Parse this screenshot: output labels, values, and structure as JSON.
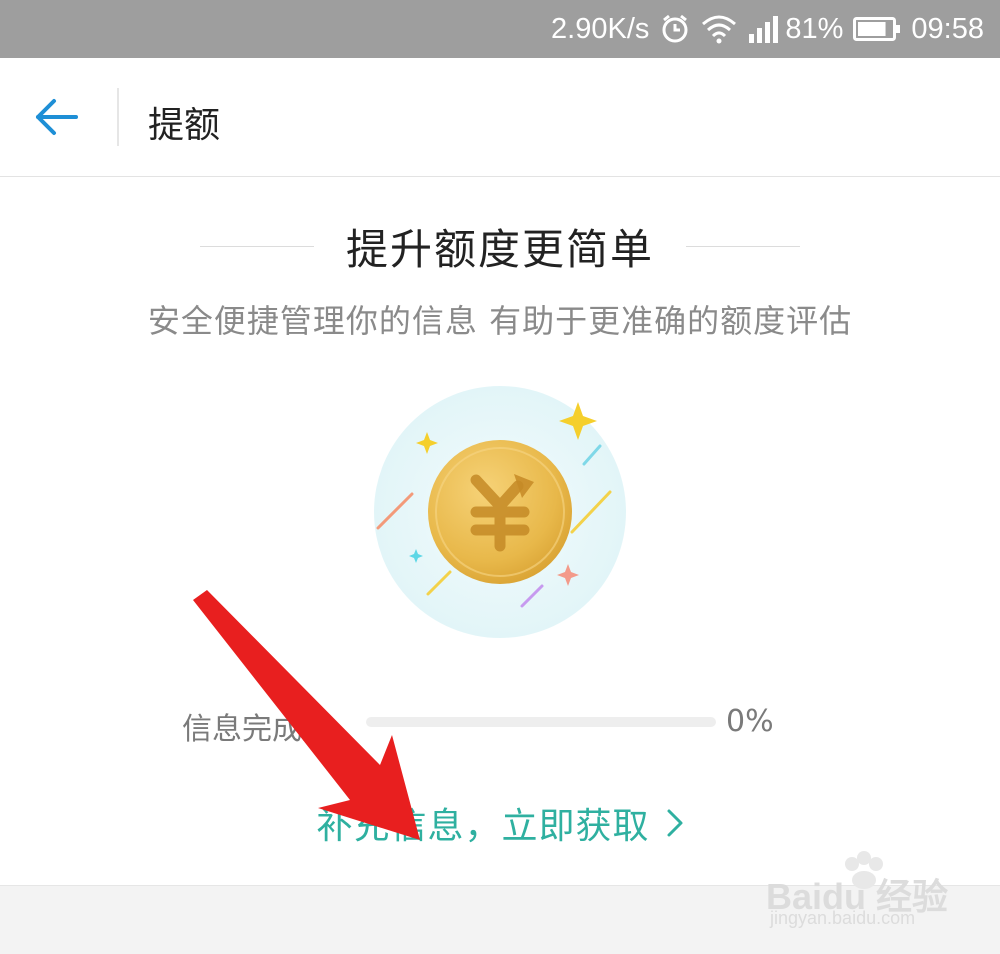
{
  "status_bar": {
    "network_speed": "2.90K/s",
    "battery_percent": "81%",
    "time": "09:58",
    "icons": [
      "alarm-icon",
      "wifi-icon",
      "signal-icon",
      "battery-icon"
    ],
    "battery_level": 0.81
  },
  "app_bar": {
    "back_icon": "arrow-left-icon",
    "title": "提额"
  },
  "main": {
    "headline": "提升额度更简单",
    "subtitle": "安全便捷管理你的信息 有助于更准确的额度评估",
    "illustration_icon": "yuan-coin-icon",
    "progress": {
      "label": "信息完成度",
      "value_text": "0%",
      "value": 0
    },
    "cta_label": "补充信息，立即获取",
    "cta_icon": "chevron-right-icon"
  },
  "watermark": {
    "brand": "Bai",
    "brand_suffix": "du 经验",
    "url": "jingyan.baidu.com"
  },
  "colors": {
    "status_bar_bg": "#9e9e9e",
    "accent_blue": "#1e8fd6",
    "accent_teal": "#2fb0a0",
    "annotation_red": "#e81f1f",
    "coin_gold": "#e8b84a"
  }
}
